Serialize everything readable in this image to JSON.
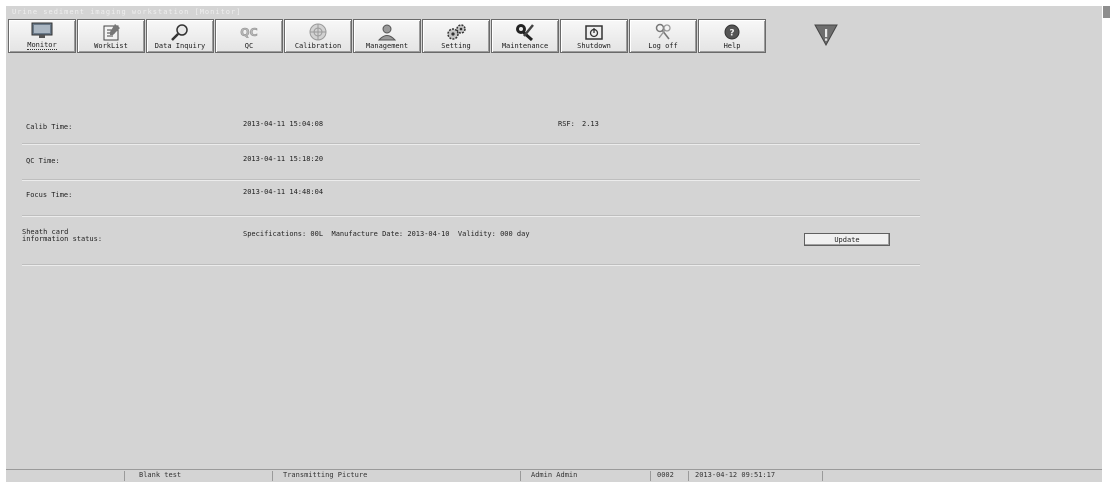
{
  "window": {
    "title": "Urine sediment imaging workstation [Monitor]"
  },
  "toolbar": [
    {
      "key": "monitor",
      "label": "Monitor",
      "icon": "monitor-icon",
      "active": true
    },
    {
      "key": "worklist",
      "label": "WorkList",
      "icon": "worklist-icon"
    },
    {
      "key": "data-inquiry",
      "label": "Data Inquiry",
      "icon": "magnifier-icon"
    },
    {
      "key": "qc",
      "label": "QC",
      "icon": "qc-icon"
    },
    {
      "key": "calibration",
      "label": "Calibration",
      "icon": "calibration-icon"
    },
    {
      "key": "management",
      "label": "Management",
      "icon": "user-management-icon"
    },
    {
      "key": "setting",
      "label": "Setting",
      "icon": "gears-icon"
    },
    {
      "key": "maintenance",
      "label": "Maintenance",
      "icon": "tools-icon"
    },
    {
      "key": "shutdown",
      "label": "Shutdown",
      "icon": "power-icon"
    },
    {
      "key": "log-off",
      "label": "Log off",
      "icon": "keys-icon"
    },
    {
      "key": "help",
      "label": "Help",
      "icon": "help-icon"
    }
  ],
  "status": {
    "calib_label": "Calib Time:",
    "calib_value": "2013-04-11 15:04:08",
    "rsf_label": "RSF:",
    "rsf_value": "2.13",
    "qc_label": "QC Time:",
    "qc_value": "2013-04-11 15:18:20",
    "focus_label": "Focus Time:",
    "focus_value": "2013-04-11 14:48:04",
    "sheath_label": "Sheath card\ninformation status:",
    "sheath_value": "Specifications: 00L  Manufacture Date: 2013-04-10  Validity: 000 day",
    "update_label": "Update"
  },
  "statusbar": {
    "mode": "Blank test",
    "action": "Transmitting Picture",
    "user": "Admin Admin",
    "code": "0002",
    "datetime": "2013-04-12 09:51:17"
  },
  "colors": {
    "background": "#d4d4d4",
    "warning": "#6e6e6e"
  }
}
